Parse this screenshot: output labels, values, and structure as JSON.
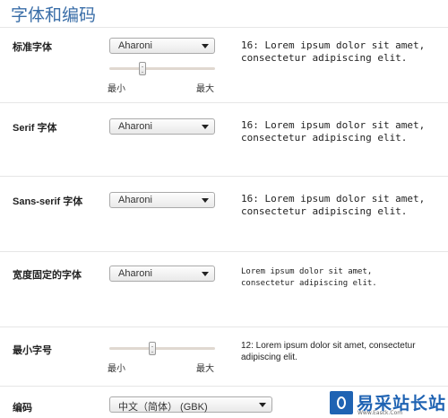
{
  "page_title": "字体和编码",
  "rows": {
    "standard": {
      "label": "标准字体",
      "font": "Aharoni",
      "preview": "16: Lorem ipsum dolor sit amet,\nconsectetur adipiscing elit.",
      "min_label": "最小",
      "max_label": "最大",
      "size_level": 0.3
    },
    "serif": {
      "label": "Serif 字体",
      "font": "Aharoni",
      "preview": "16: Lorem ipsum dolor sit amet,\nconsectetur adipiscing elit."
    },
    "sans": {
      "label": "Sans-serif 字体",
      "font": "Aharoni",
      "preview": "16: Lorem ipsum dolor sit amet,\nconsectetur adipiscing elit."
    },
    "fixed": {
      "label": "宽度固定的字体",
      "font": "Aharoni",
      "preview": "Lorem ipsum dolor sit amet,\nconsectetur adipiscing elit."
    },
    "minsize": {
      "label": "最小字号",
      "preview": "12: Lorem ipsum dolor sit amet, consectetur adipiscing elit.",
      "min_label": "最小",
      "max_label": "最大",
      "size_level": 0.4
    },
    "encoding": {
      "label": "编码",
      "value": "中文（简体） (GBK)"
    }
  },
  "watermark": {
    "text": "易采站长站",
    "sub": "Www.Easck.Com"
  }
}
